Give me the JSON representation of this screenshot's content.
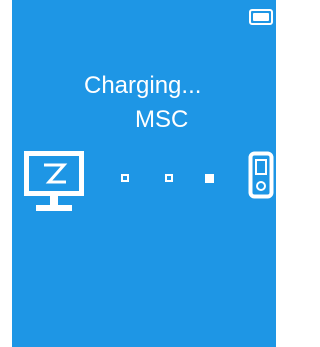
{
  "status": {
    "title": "Charging...",
    "mode": "MSC"
  },
  "icons": {
    "battery": "battery-full-icon",
    "computer": "computer-monitor-icon",
    "transfer": "transfer-dots-icon",
    "device": "media-player-icon"
  },
  "colors": {
    "background": "#1e96e5",
    "foreground": "#ffffff"
  }
}
